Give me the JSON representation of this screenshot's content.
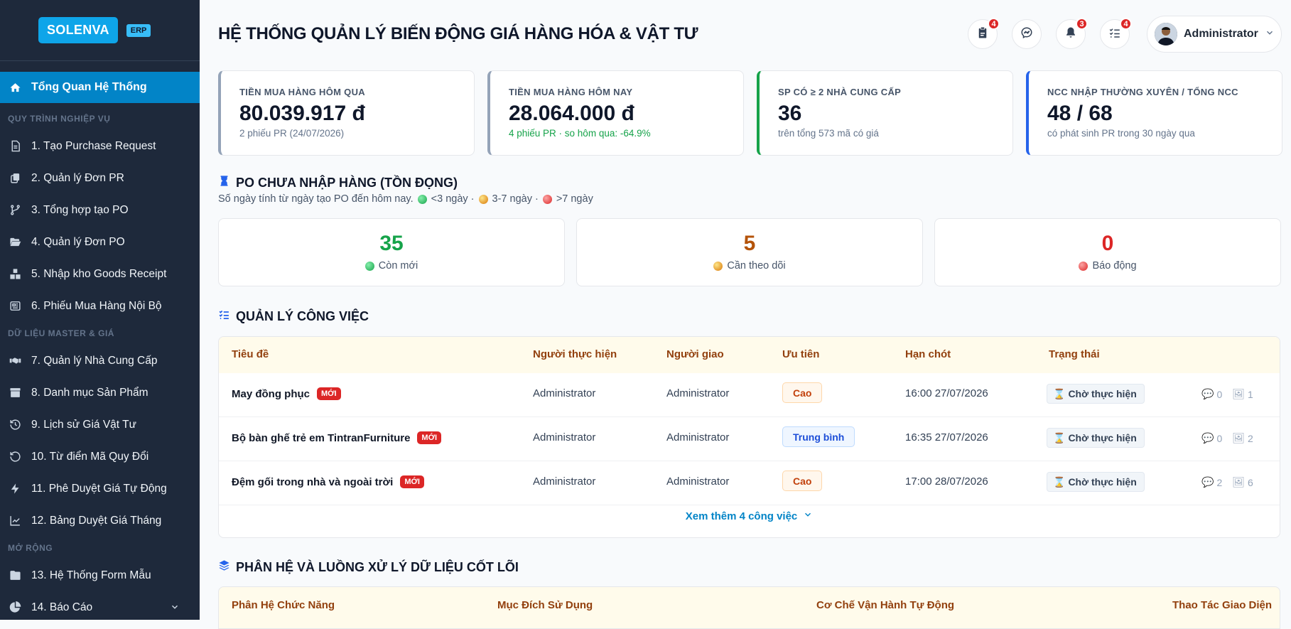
{
  "sidebar": {
    "logo": "SOLENVA",
    "erp_badge": "ERP",
    "active_item": "Tổng Quan Hệ Thống",
    "groups": {
      "g1": "QUY TRÌNH NGHIỆP VỤ",
      "g2": "DỮ LIỆU MASTER & GIÁ",
      "g3": "MỞ RỘNG"
    },
    "items": [
      {
        "label": "1. Tạo Purchase Request",
        "icon": "file-icon"
      },
      {
        "label": "2. Quản lý Đơn PR",
        "icon": "copy-icon"
      },
      {
        "label": "3. Tổng hợp tạo PO",
        "icon": "branch-icon"
      },
      {
        "label": "4. Quản lý Đơn PO",
        "icon": "folder-open-icon"
      },
      {
        "label": "5. Nhập kho Goods Receipt",
        "icon": "boxes-icon"
      },
      {
        "label": "6. Phiếu Mua Hàng Nội Bộ",
        "icon": "newspaper-icon"
      },
      {
        "label": "7. Quản lý Nhà Cung Cấp",
        "icon": "handshake-icon"
      },
      {
        "label": "8. Danh mục Sản Phẩm",
        "icon": "archive-icon"
      },
      {
        "label": "9. Lịch sử Giá Vật Tư",
        "icon": "history-icon"
      },
      {
        "label": "10. Từ điển Mã Quy Đổi",
        "icon": "undo-icon"
      },
      {
        "label": "11. Phê Duyệt Giá Tự Động",
        "icon": "bolt-icon"
      },
      {
        "label": "12. Bảng Duyệt Giá Tháng",
        "icon": "chart-line-icon"
      },
      {
        "label": "13. Hệ Thống Form Mẫu",
        "icon": "folder-icon"
      },
      {
        "label": "14. Báo Cáo",
        "icon": "pie-chart-icon"
      }
    ]
  },
  "header": {
    "title": "HỆ THỐNG QUẢN LÝ BIẾN ĐỘNG GIÁ HÀNG HÓA & VẬT TƯ",
    "badges": {
      "clipboard": "4",
      "bell": "3",
      "tasks": "4"
    },
    "user": "Administrator"
  },
  "stats": [
    {
      "label": "TIỀN MUA HÀNG HÔM QUA",
      "value": "80.039.917 đ",
      "sub": "2 phiếu PR (24/07/2026)",
      "accent": "#94a3b8"
    },
    {
      "label": "TIỀN MUA HÀNG HÔM NAY",
      "value": "28.064.000 đ",
      "sub": "4 phiếu PR · so hôm qua: -64.9%",
      "accent": "#94a3b8"
    },
    {
      "label": "SP CÓ ≥ 2 NHÀ CUNG CẤP",
      "value": "36",
      "sub": "trên tổng 573 mã có giá",
      "accent": "#16a34a"
    },
    {
      "label": "NCC NHẬP THƯỜNG XUYÊN / TỔNG NCC",
      "value": "48 / 68",
      "sub": "có phát sinh PR trong 30 ngày qua",
      "accent": "#2563eb"
    }
  ],
  "po": {
    "title": "PO CHƯA NHẬP HÀNG (TỒN ĐỌNG)",
    "subtitle": "Số ngày tính từ ngày tạo PO đến hôm nay.",
    "legend": [
      "<3 ngày ·",
      "3-7 ngày ·",
      ">7 ngày"
    ],
    "cards": [
      {
        "value": "35",
        "label": "Còn mới",
        "color": "#16a34a"
      },
      {
        "value": "5",
        "label": "Cần theo dõi",
        "color": "#b45309"
      },
      {
        "value": "0",
        "label": "Báo động",
        "color": "#dc2626"
      }
    ]
  },
  "tasks": {
    "title": "QUẢN LÝ CÔNG VIỆC",
    "columns": [
      "Tiêu đề",
      "Người thực hiện",
      "Người giao",
      "Ưu tiên",
      "Hạn chót",
      "Trạng thái"
    ],
    "new_label": "MỚI",
    "rows": [
      {
        "title": "May đồng phục",
        "assignee": "Administrator",
        "assigner": "Administrator",
        "priority": "Cao",
        "deadline": "16:00 27/07/2026",
        "status": "Chờ thực hiện",
        "comments": "0",
        "images": "1"
      },
      {
        "title": "Bộ bàn ghế trẻ em TintranFurniture",
        "assignee": "Administrator",
        "assigner": "Administrator",
        "priority": "Trung bình",
        "deadline": "16:35 27/07/2026",
        "status": "Chờ thực hiện",
        "comments": "0",
        "images": "2"
      },
      {
        "title": "Đệm gối trong nhà và ngoài trời",
        "assignee": "Administrator",
        "assigner": "Administrator",
        "priority": "Cao",
        "deadline": "17:00 28/07/2026",
        "status": "Chờ thực hiện",
        "comments": "2",
        "images": "6"
      }
    ],
    "more": "Xem thêm 4 công việc"
  },
  "core": {
    "title": "PHÂN HỆ VÀ LUỒNG XỬ LÝ DỮ LIỆU CỐT LÕI",
    "columns": [
      "Phân Hệ Chức Năng",
      "Mục Đích Sử Dụng",
      "Cơ Chế Vận Hành Tự Động",
      "Thao Tác Giao Diện"
    ]
  }
}
